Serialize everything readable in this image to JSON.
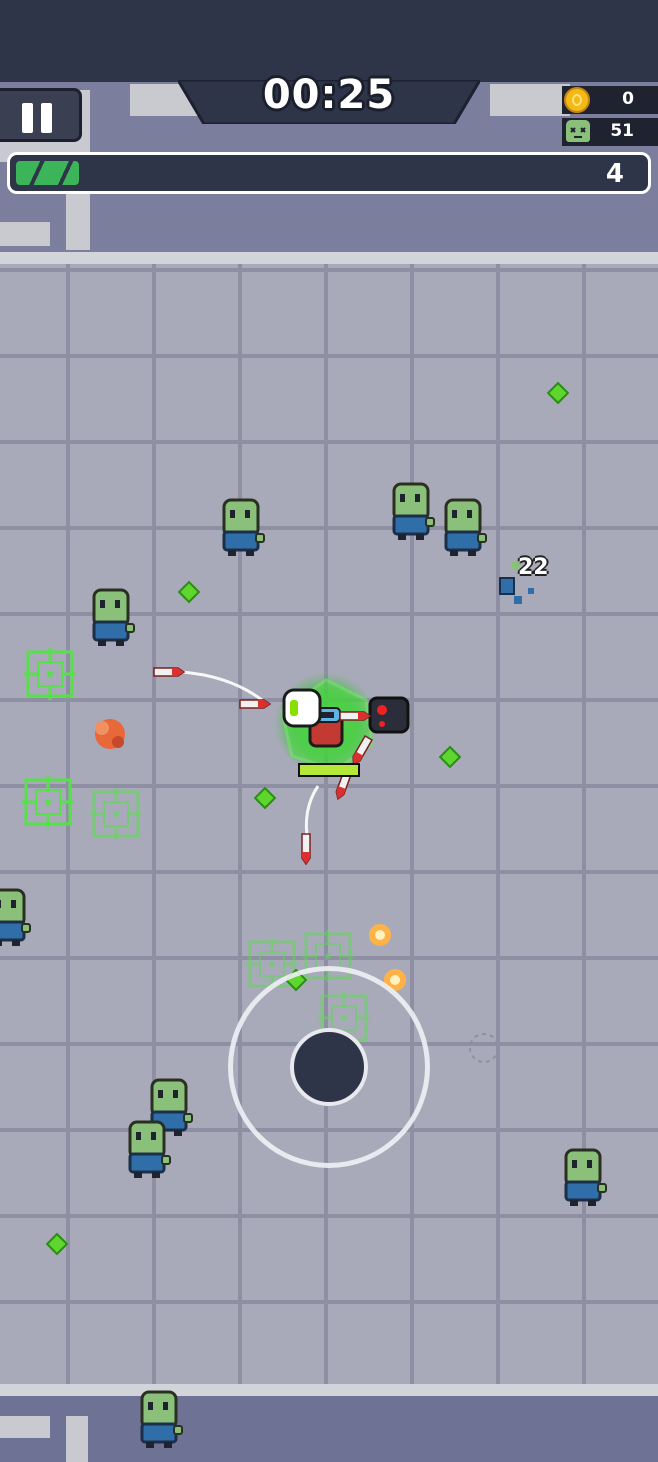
{
  "hud": {
    "timer": "00:25",
    "coins": "0",
    "kills": "51",
    "level": "4",
    "xp_progress": 0.12,
    "pause_icon": "pause-icon",
    "coin_icon": "coin-icon",
    "kills_icon": "zombie-skull-icon"
  },
  "combat": {
    "damage_number": "22",
    "player_health": 1.0
  },
  "colors": {
    "accent_green": "#3cb55a",
    "hud_dark": "#2f3548",
    "gem_green": "#5fd62e",
    "zombie_green": "#8bc07a",
    "zombie_shirt": "#2f6ea8"
  }
}
